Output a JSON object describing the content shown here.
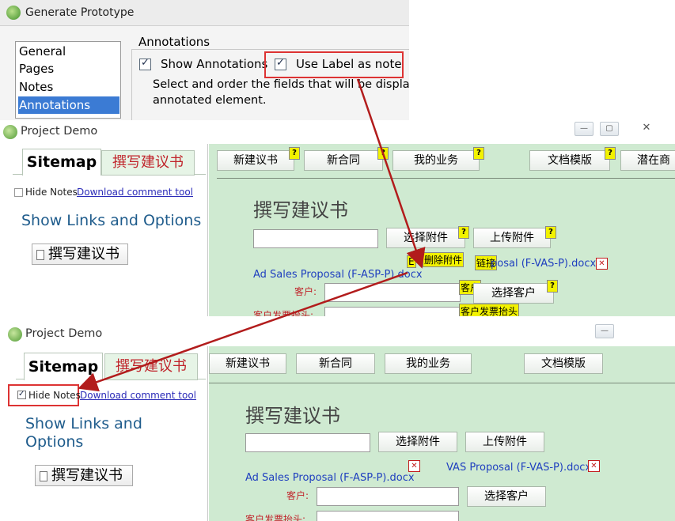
{
  "gen_prototype": {
    "title": "Generate Prototype",
    "list_items": [
      "General",
      "Pages",
      "Notes",
      "Annotations"
    ],
    "selected_index": 3,
    "group_title": "Annotations",
    "show_annotations": {
      "label": "Show Annotations",
      "checked": true
    },
    "use_label_as_note": {
      "label": "Use Label as note",
      "checked": true
    },
    "desc_line1": "Select and order the fields that will be display",
    "desc_line2": "annotated element."
  },
  "window1": {
    "title": "Project Demo",
    "tabs": {
      "sitemap": "Sitemap",
      "write": "撰写建议书"
    },
    "hide_notes": {
      "label": "Hide Notes",
      "checked": false
    },
    "download_link": "Download comment tool",
    "show_links": "Show Links and Options",
    "sitemap_item": "撰写建议书",
    "nav": [
      "新建议书",
      "新合同",
      "我的业务",
      "文档模版",
      "潜在商"
    ],
    "note_marker": "?",
    "page_heading": "撰写建议书",
    "buttons": {
      "select_attachment": "选择附件",
      "upload_attachment": "上传附件",
      "select_customer": "选择客户"
    },
    "file1": "Ad Sales Proposal (F-ASP-P).docx",
    "file2": "posal (F-VAS-P).docx",
    "delete_icon": "✕",
    "label_customer": "客户:",
    "label_invoice": "客户发票抬头:",
    "notes": {
      "delete_attachment": "删除附件",
      "link": "链接",
      "customer": "客户",
      "invoice": "客户发票抬头",
      "e_prefix": "E"
    }
  },
  "window2": {
    "title": "Project Demo",
    "tabs": {
      "sitemap": "Sitemap",
      "write": "撰写建议书"
    },
    "hide_notes": {
      "label": "Hide Notes",
      "checked": true
    },
    "download_link": "Download comment tool",
    "show_links_1": "Show Links and",
    "show_links_2": "Options",
    "sitemap_item": "撰写建议书",
    "nav": [
      "新建议书",
      "新合同",
      "我的业务",
      "文档模版"
    ],
    "page_heading": "撰写建议书",
    "buttons": {
      "select_attachment": "选择附件",
      "upload_attachment": "上传附件",
      "select_customer": "选择客户"
    },
    "file1": "Ad Sales Proposal (F-ASP-P).docx",
    "file2": "VAS Proposal (F-VAS-P).docx",
    "delete_icon": "✕",
    "label_customer": "客户:",
    "label_invoice": "客户发票抬头:"
  },
  "colors": {
    "highlight": "#dd3333",
    "arrow": "#b21c1c",
    "content_bg": "#cfead1",
    "note_yellow": "#f2f200"
  }
}
